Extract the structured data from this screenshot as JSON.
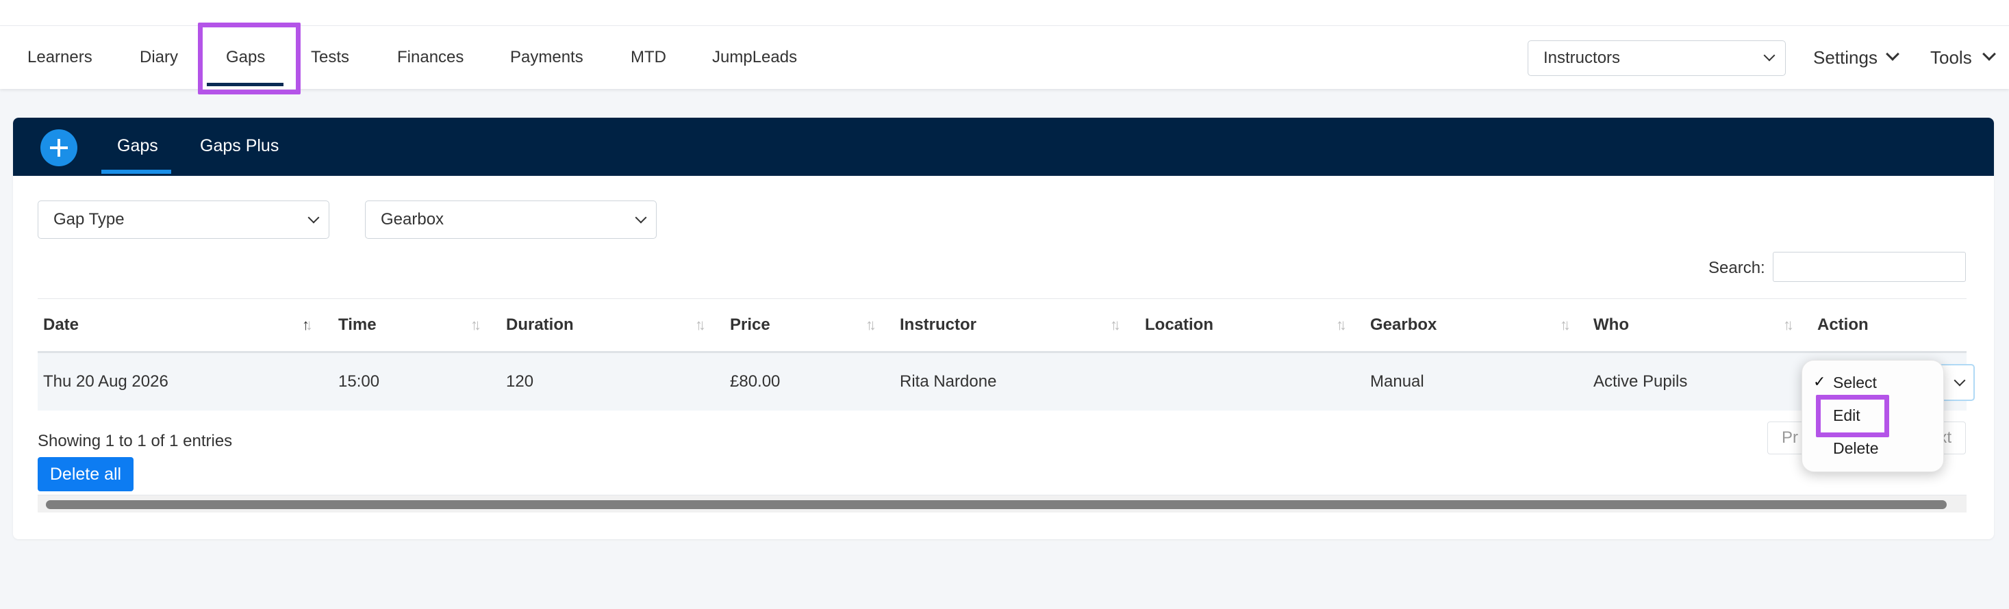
{
  "nav": {
    "items": [
      "Learners",
      "Diary",
      "Gaps",
      "Tests",
      "Finances",
      "Payments",
      "MTD",
      "JumpLeads"
    ],
    "active": "Gaps",
    "instructors_select": "Instructors",
    "settings_label": "Settings",
    "tools_label": "Tools"
  },
  "card": {
    "tabs": [
      "Gaps",
      "Gaps Plus"
    ],
    "active_tab": "Gaps",
    "filters": {
      "gap_type": "Gap Type",
      "gearbox": "Gearbox"
    },
    "search_label": "Search:",
    "search_value": ""
  },
  "table": {
    "columns": [
      "Date",
      "Time",
      "Duration",
      "Price",
      "Instructor",
      "Location",
      "Gearbox",
      "Who",
      "Action"
    ],
    "rows": [
      {
        "date": "Thu 20 Aug 2026",
        "time": "15:00",
        "duration": "120",
        "price": "£80.00",
        "instructor": "Rita Nardone",
        "location": "",
        "gearbox": "Manual",
        "who": "Active Pupils"
      }
    ],
    "info": "Showing 1 to 1 of 1 entries",
    "delete_all": "Delete all",
    "pager": {
      "previous_fragment": "Pr",
      "next_fragment": "xt"
    }
  },
  "action_dropdown": {
    "options": [
      "Select",
      "Edit",
      "Delete"
    ],
    "selected": "Select"
  },
  "colors": {
    "header_bg": "#002244",
    "accent_blue": "#0d7cf2",
    "highlight_purple": "#b454e8"
  }
}
